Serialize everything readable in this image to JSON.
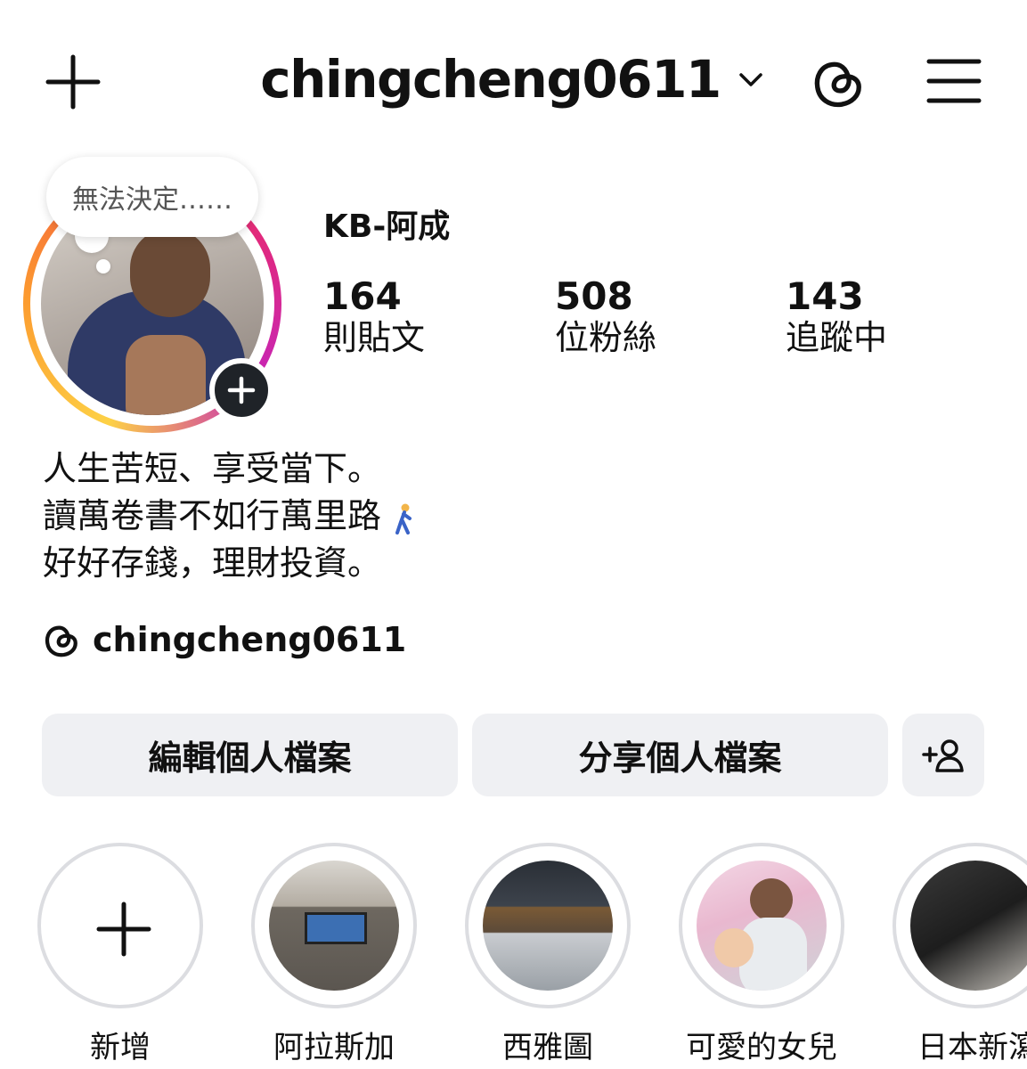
{
  "header": {
    "username": "chingcheng0611"
  },
  "profile": {
    "note": "無法決定……",
    "display_name": "KB-阿成",
    "stats": [
      {
        "number": "164",
        "label": "則貼文"
      },
      {
        "number": "508",
        "label": "位粉絲"
      },
      {
        "number": "143",
        "label": "追蹤中"
      }
    ],
    "bio": [
      "人生苦短、享受當下。",
      "讀萬卷書不如行萬里路",
      "好好存錢，理財投資。"
    ],
    "threads_handle": "chingcheng0611"
  },
  "actions": {
    "edit_label": "編輯個人檔案",
    "share_label": "分享個人檔案"
  },
  "highlights": [
    {
      "label": "新增"
    },
    {
      "label": "阿拉斯加"
    },
    {
      "label": "西雅圖"
    },
    {
      "label": "可愛的女兒"
    },
    {
      "label": "日本新瀉"
    }
  ],
  "colors": {
    "story_ring": [
      "#fdd146",
      "#f35b3f",
      "#e2297b",
      "#c626b6"
    ],
    "button_bg": "#eff0f3",
    "text": "#111111"
  },
  "icons": [
    "plus-icon",
    "chevron-down-icon",
    "threads-icon",
    "menu-icon",
    "add-person-icon",
    "walking-person-emoji"
  ]
}
